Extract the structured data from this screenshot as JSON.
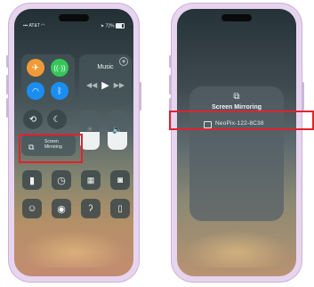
{
  "left_phone": {
    "status": {
      "carrier": "AT&T",
      "battery": "72%"
    },
    "music": {
      "title": "Music"
    },
    "screen_mirroring": {
      "label_line1": "Screen",
      "label_line2": "Mirroring"
    },
    "brightness_level": 0.45,
    "volume_level": 0.45
  },
  "right_phone": {
    "sheet_title": "Screen Mirroring",
    "devices": [
      {
        "name": "NeoPix-122-8C38"
      }
    ]
  },
  "colors": {
    "highlight": "#e0232c",
    "airplane_active": "#f29a37",
    "wireless_active": "#35c759",
    "wifi_active": "#1a8ef0",
    "bluetooth_active": "#1a8ef0"
  }
}
